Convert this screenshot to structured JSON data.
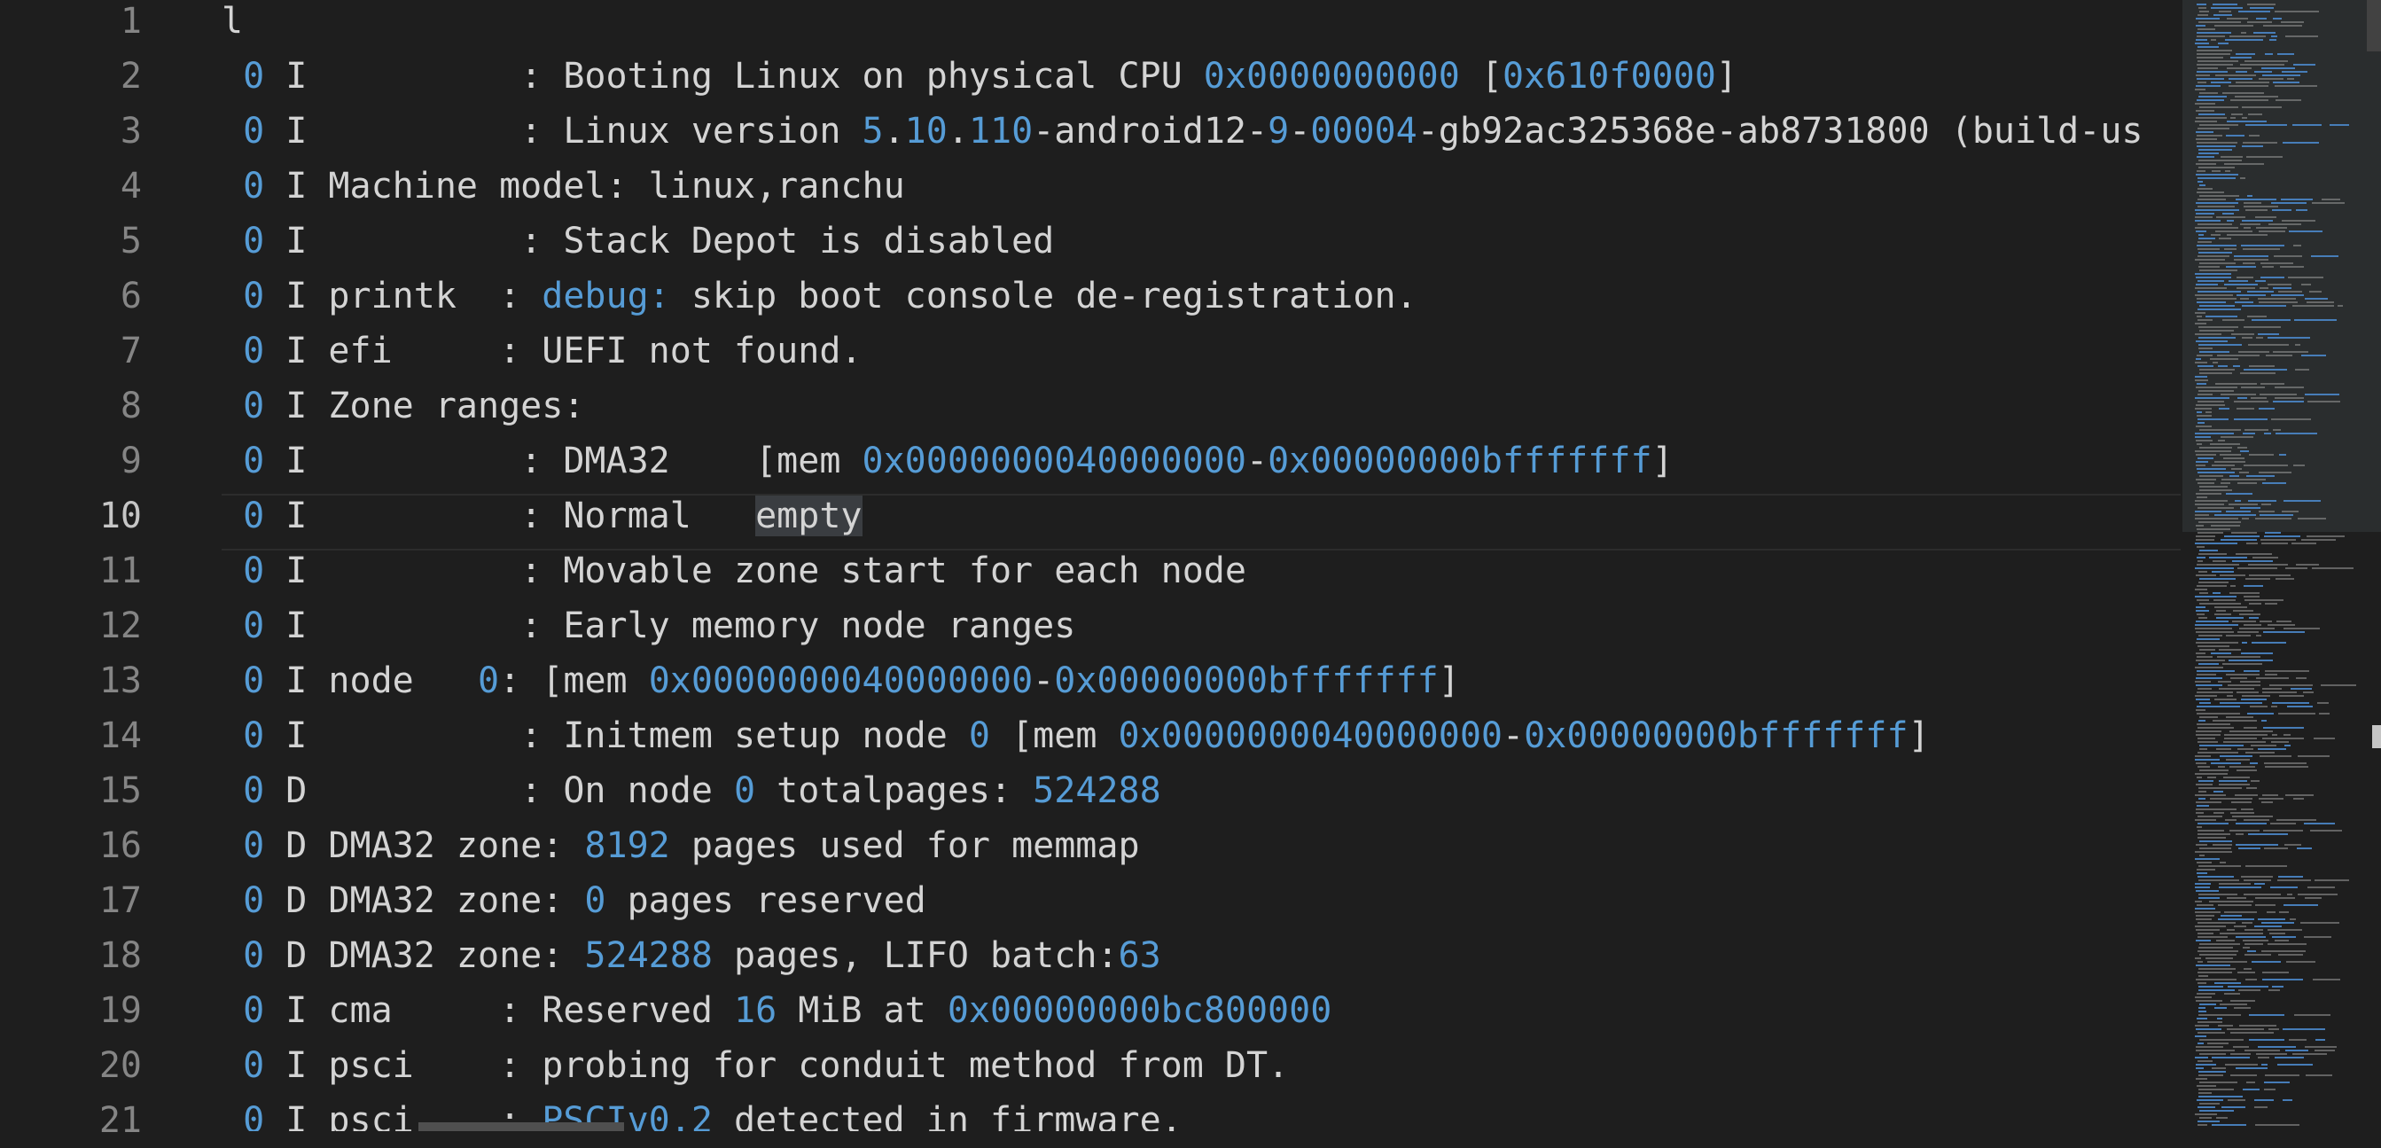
{
  "editor": {
    "lines": [
      {
        "n": "1",
        "parts": [
          {
            "t": "l"
          }
        ]
      },
      {
        "n": "2",
        "parts": [
          {
            "t": " "
          },
          {
            "t": "0",
            "c": "num"
          },
          {
            "t": " I          : Booting Linux on physical CPU "
          },
          {
            "t": "0x0000000000",
            "c": "num"
          },
          {
            "t": " ["
          },
          {
            "t": "0x610f0000",
            "c": "num"
          },
          {
            "t": "]"
          }
        ]
      },
      {
        "n": "3",
        "parts": [
          {
            "t": " "
          },
          {
            "t": "0",
            "c": "num"
          },
          {
            "t": " I          : Linux version "
          },
          {
            "t": "5",
            "c": "num"
          },
          {
            "t": "."
          },
          {
            "t": "10",
            "c": "num"
          },
          {
            "t": "."
          },
          {
            "t": "110",
            "c": "num"
          },
          {
            "t": "-android12-"
          },
          {
            "t": "9",
            "c": "num"
          },
          {
            "t": "-"
          },
          {
            "t": "00004",
            "c": "num"
          },
          {
            "t": "-gb92ac325368e-ab8731800 (build-us"
          }
        ]
      },
      {
        "n": "4",
        "parts": [
          {
            "t": " "
          },
          {
            "t": "0",
            "c": "num"
          },
          {
            "t": " I Machine model: linux,ranchu"
          }
        ]
      },
      {
        "n": "5",
        "parts": [
          {
            "t": " "
          },
          {
            "t": "0",
            "c": "num"
          },
          {
            "t": " I          : Stack Depot is disabled"
          }
        ]
      },
      {
        "n": "6",
        "parts": [
          {
            "t": " "
          },
          {
            "t": "0",
            "c": "num"
          },
          {
            "t": " I printk  : "
          },
          {
            "t": "debug:",
            "c": "num"
          },
          {
            "t": " skip boot console de-registration."
          }
        ]
      },
      {
        "n": "7",
        "parts": [
          {
            "t": " "
          },
          {
            "t": "0",
            "c": "num"
          },
          {
            "t": " I efi     : UEFI not found."
          }
        ]
      },
      {
        "n": "8",
        "parts": [
          {
            "t": " "
          },
          {
            "t": "0",
            "c": "num"
          },
          {
            "t": " I Zone ranges:"
          }
        ]
      },
      {
        "n": "9",
        "parts": [
          {
            "t": " "
          },
          {
            "t": "0",
            "c": "num"
          },
          {
            "t": " I          : DMA32    [mem "
          },
          {
            "t": "0x0000000040000000",
            "c": "num"
          },
          {
            "t": "-"
          },
          {
            "t": "0x00000000bfffffff",
            "c": "num"
          },
          {
            "t": "]"
          }
        ]
      },
      {
        "n": "10",
        "parts": [
          {
            "t": " "
          },
          {
            "t": "0",
            "c": "num"
          },
          {
            "t": " I          : Normal   "
          },
          {
            "t": "empty",
            "c": "hl"
          }
        ]
      },
      {
        "n": "11",
        "parts": [
          {
            "t": " "
          },
          {
            "t": "0",
            "c": "num"
          },
          {
            "t": " I          : Movable zone start for each node"
          }
        ]
      },
      {
        "n": "12",
        "parts": [
          {
            "t": " "
          },
          {
            "t": "0",
            "c": "num"
          },
          {
            "t": " I          : Early memory node ranges"
          }
        ]
      },
      {
        "n": "13",
        "parts": [
          {
            "t": " "
          },
          {
            "t": "0",
            "c": "num"
          },
          {
            "t": " I node   "
          },
          {
            "t": "0",
            "c": "num"
          },
          {
            "t": ": [mem "
          },
          {
            "t": "0x0000000040000000",
            "c": "num"
          },
          {
            "t": "-"
          },
          {
            "t": "0x00000000bfffffff",
            "c": "num"
          },
          {
            "t": "]"
          }
        ]
      },
      {
        "n": "14",
        "parts": [
          {
            "t": " "
          },
          {
            "t": "0",
            "c": "num"
          },
          {
            "t": " I          : Initmem setup node "
          },
          {
            "t": "0",
            "c": "num"
          },
          {
            "t": " [mem "
          },
          {
            "t": "0x0000000040000000",
            "c": "num"
          },
          {
            "t": "-"
          },
          {
            "t": "0x00000000bfffffff",
            "c": "num"
          },
          {
            "t": "]"
          }
        ]
      },
      {
        "n": "15",
        "parts": [
          {
            "t": " "
          },
          {
            "t": "0",
            "c": "num"
          },
          {
            "t": " D          : On node "
          },
          {
            "t": "0",
            "c": "num"
          },
          {
            "t": " totalpages: "
          },
          {
            "t": "524288",
            "c": "num"
          }
        ]
      },
      {
        "n": "16",
        "parts": [
          {
            "t": " "
          },
          {
            "t": "0",
            "c": "num"
          },
          {
            "t": " D DMA32 zone: "
          },
          {
            "t": "8192",
            "c": "num"
          },
          {
            "t": " pages used for memmap"
          }
        ]
      },
      {
        "n": "17",
        "parts": [
          {
            "t": " "
          },
          {
            "t": "0",
            "c": "num"
          },
          {
            "t": " D DMA32 zone: "
          },
          {
            "t": "0",
            "c": "num"
          },
          {
            "t": " pages reserved"
          }
        ]
      },
      {
        "n": "18",
        "parts": [
          {
            "t": " "
          },
          {
            "t": "0",
            "c": "num"
          },
          {
            "t": " D DMA32 zone: "
          },
          {
            "t": "524288",
            "c": "num"
          },
          {
            "t": " pages, LIFO batch:"
          },
          {
            "t": "63",
            "c": "num"
          }
        ]
      },
      {
        "n": "19",
        "parts": [
          {
            "t": " "
          },
          {
            "t": "0",
            "c": "num"
          },
          {
            "t": " I cma     : Reserved "
          },
          {
            "t": "16",
            "c": "num"
          },
          {
            "t": " MiB at "
          },
          {
            "t": "0x00000000bc800000",
            "c": "num"
          }
        ]
      },
      {
        "n": "20",
        "parts": [
          {
            "t": " "
          },
          {
            "t": "0",
            "c": "num"
          },
          {
            "t": " I psci    : probing for conduit method from DT."
          }
        ]
      },
      {
        "n": "21",
        "parts": [
          {
            "t": " "
          },
          {
            "t": "0",
            "c": "num"
          },
          {
            "t": " I psci    : "
          },
          {
            "t": "PSCIv0.2",
            "c": "num"
          },
          {
            "t": " detected in firmware."
          }
        ]
      }
    ],
    "active_line": "10"
  },
  "colors": {
    "background": "#1e1e1e",
    "text": "#d4d4d4",
    "number": "#569cd6",
    "line_number": "#858585",
    "line_number_active": "#c6c6c6",
    "word_highlight": "#3a3d41"
  }
}
